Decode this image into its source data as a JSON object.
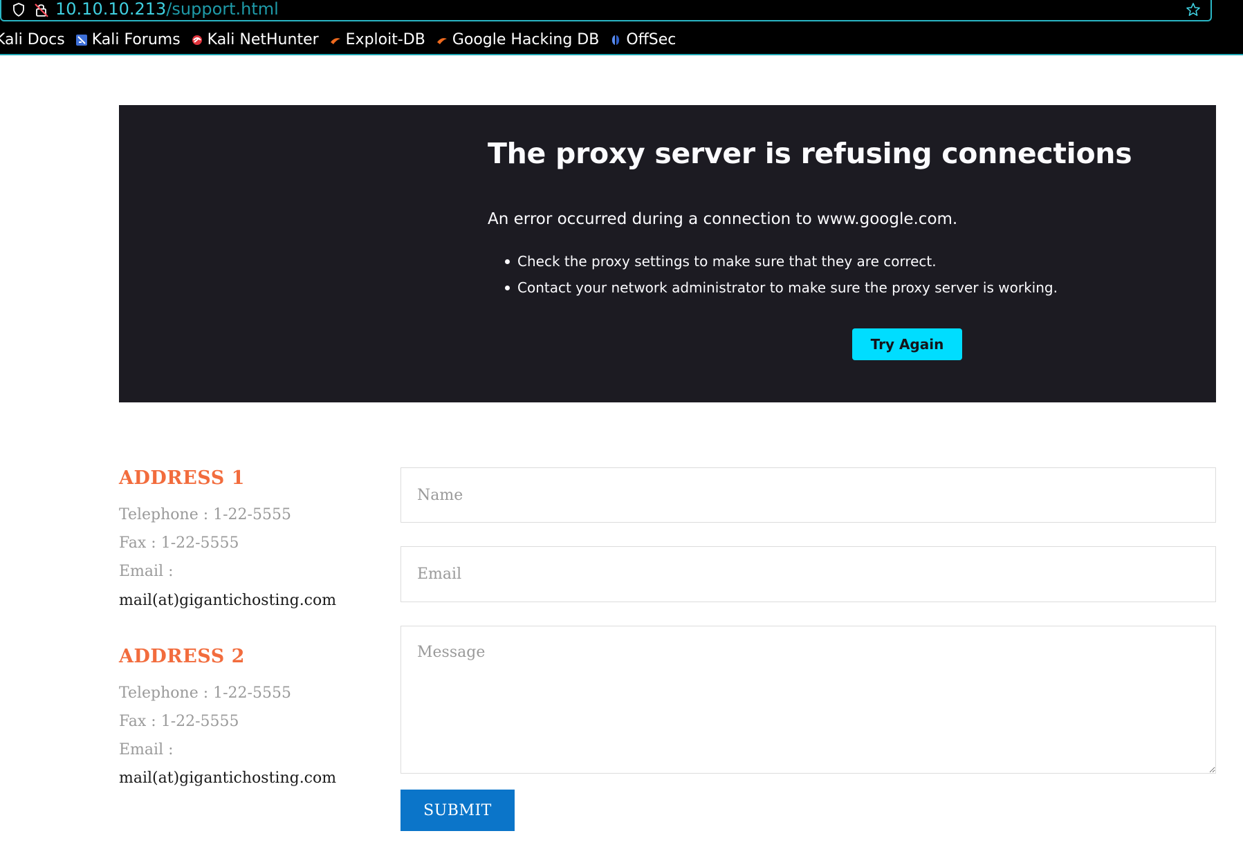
{
  "browser": {
    "url_host": "10.10.10.213",
    "url_path": "/support.html",
    "bookmarks": [
      {
        "label": "Kali Docs",
        "icon": "kali-docs-icon"
      },
      {
        "label": "Kali Forums",
        "icon": "kali-forums-icon"
      },
      {
        "label": "Kali NetHunter",
        "icon": "kali-nethunter-icon"
      },
      {
        "label": "Exploit-DB",
        "icon": "exploit-db-icon"
      },
      {
        "label": "Google Hacking DB",
        "icon": "google-hacking-db-icon"
      },
      {
        "label": "OffSec",
        "icon": "offsec-icon"
      }
    ]
  },
  "error": {
    "title": "The proxy server is refusing connections",
    "description": "An error occurred during a connection to www.google.com.",
    "items": [
      "Check the proxy settings to make sure that they are correct.",
      "Contact your network administrator to make sure the proxy server is working."
    ],
    "try_again_label": "Try Again"
  },
  "addresses": [
    {
      "title": "ADDRESS 1",
      "telephone": "Telephone : 1-22-5555",
      "fax": "Fax : 1-22-5555",
      "email_label": "Email :",
      "email": "mail(at)gigantichosting.com"
    },
    {
      "title": "ADDRESS 2",
      "telephone": "Telephone : 1-22-5555",
      "fax": "Fax : 1-22-5555",
      "email_label": "Email :",
      "email": "mail(at)gigantichosting.com"
    }
  ],
  "form": {
    "name_placeholder": "Name",
    "email_placeholder": "Email",
    "message_placeholder": "Message",
    "submit_label": "SUBMIT"
  },
  "colors": {
    "accent_cyan": "#00ddff",
    "address_title": "#f26c3d",
    "submit_blue": "#0b75c9",
    "error_bg": "#1c1b22"
  }
}
